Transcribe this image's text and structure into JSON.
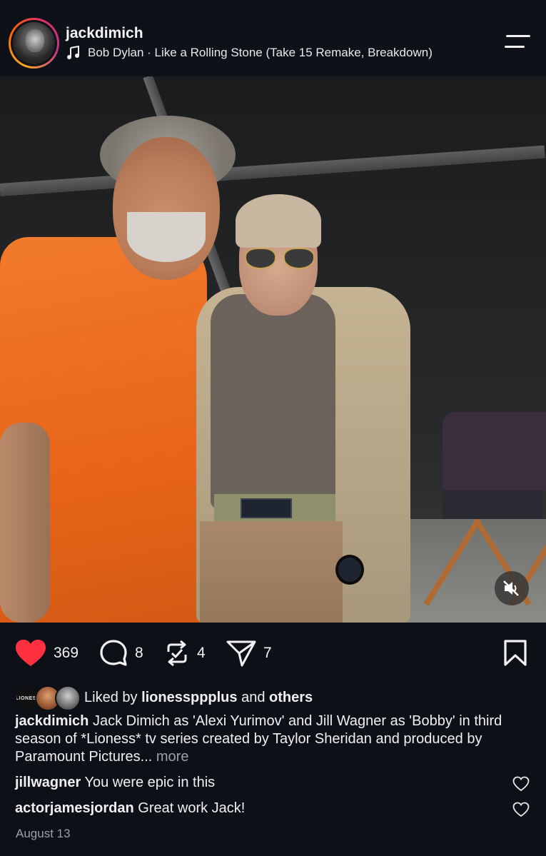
{
  "header": {
    "username": "jackdimich",
    "song": "Bob Dylan · Like a Rolling Stone (Take 15 Remake, Breakdown)",
    "icons": [
      "music-note-icon",
      "menu-icon"
    ]
  },
  "post": {
    "media_controls": {
      "mute_icon": "speaker-muted-icon"
    }
  },
  "actions": {
    "likes": "369",
    "comments": "8",
    "reposts": "4",
    "shares": "7",
    "liked": true,
    "colors": {
      "like_red": "#ff3040"
    }
  },
  "liked_by": {
    "prefix": "Liked by",
    "user": "lionessppplus",
    "joiner": "and",
    "others": "others",
    "avatar_label": "LIONESS"
  },
  "caption": {
    "username": "jackdimich",
    "text": "Jack Dimich as 'Alexi Yurimov' and Jill Wagner as 'Bobby' in third season of *Lioness* tv series created by Taylor Sheridan and produced by Paramount Pictures...",
    "more": "more"
  },
  "comments": [
    {
      "username": "jillwagner",
      "text": "You were epic in this"
    },
    {
      "username": "actorjamesjordan",
      "text": "Great work Jack!"
    }
  ],
  "date": "August 13"
}
